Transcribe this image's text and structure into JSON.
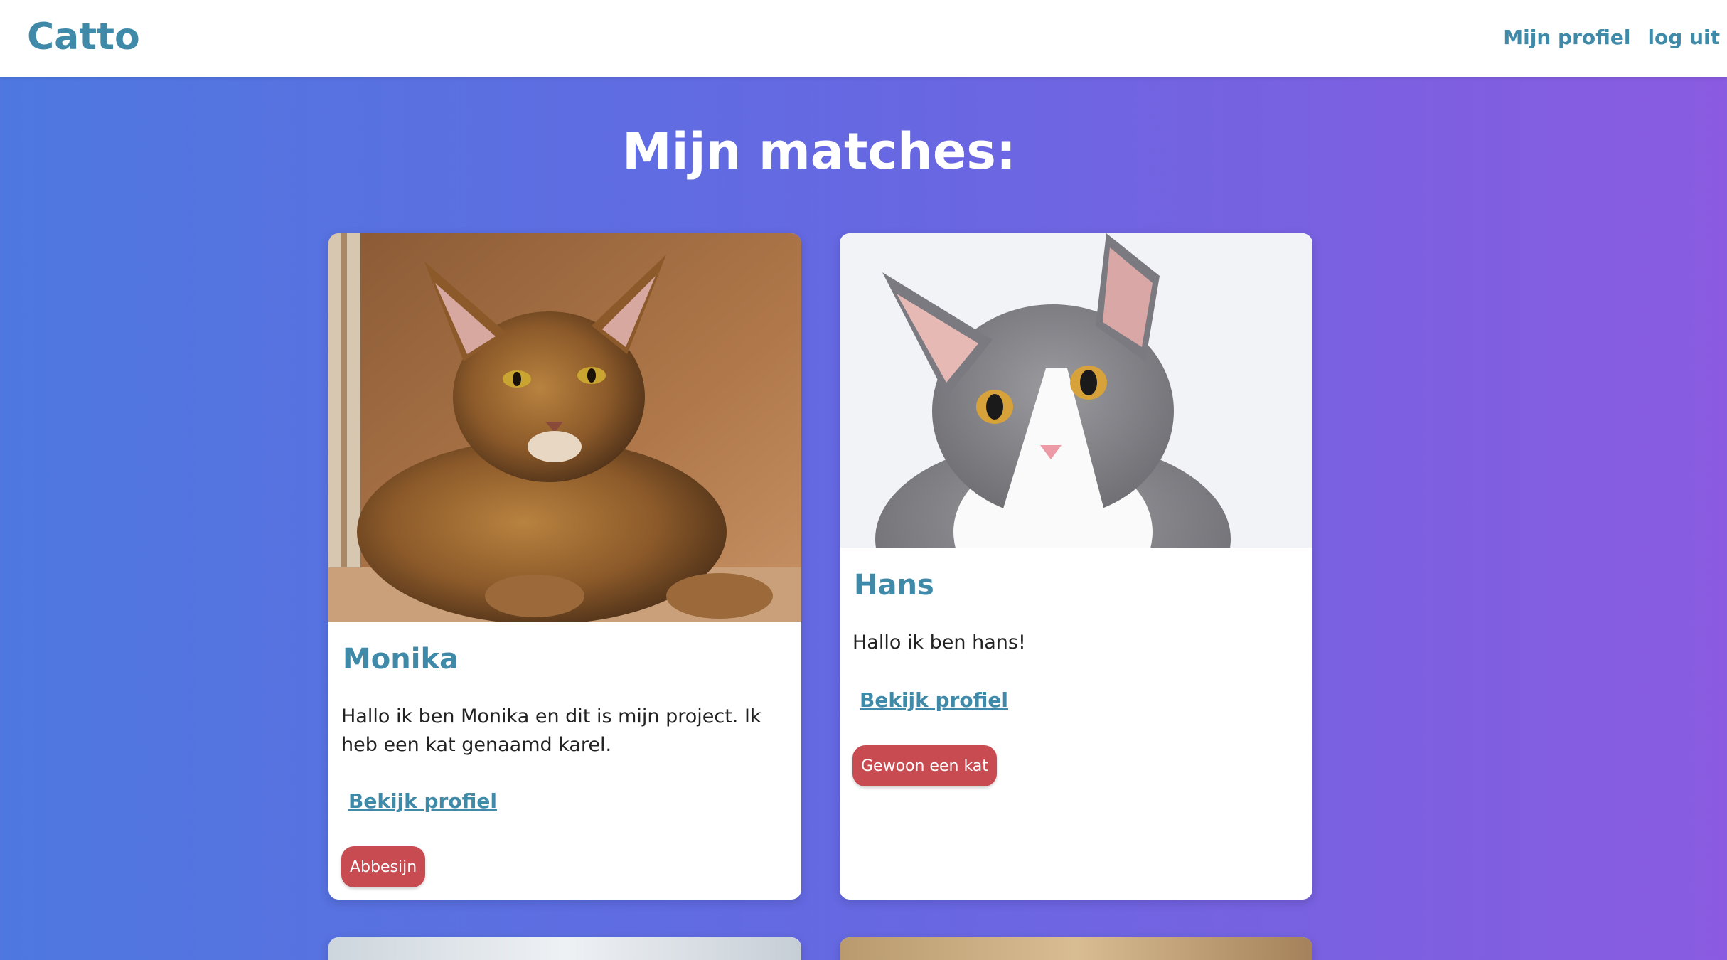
{
  "header": {
    "logo": "Catto",
    "nav": [
      "Mijn profiel",
      "log uit"
    ]
  },
  "page_title": "Mijn matches:",
  "cards": [
    {
      "name": "Monika",
      "description": "Hallo ik ben Monika en dit is mijn project. Ik heb een kat genaamd karel.",
      "link": "Bekijk profiel",
      "tag": "Abbesijn"
    },
    {
      "name": "Hans",
      "description": "Hallo ik ben hans!",
      "link": "Bekijk profiel",
      "tag": "Gewoon een kat"
    }
  ],
  "colors": {
    "brand": "#3f8aa8",
    "tag": "#c94b52",
    "gradient_start": "#4e78e0",
    "gradient_end": "#8a5be0"
  }
}
